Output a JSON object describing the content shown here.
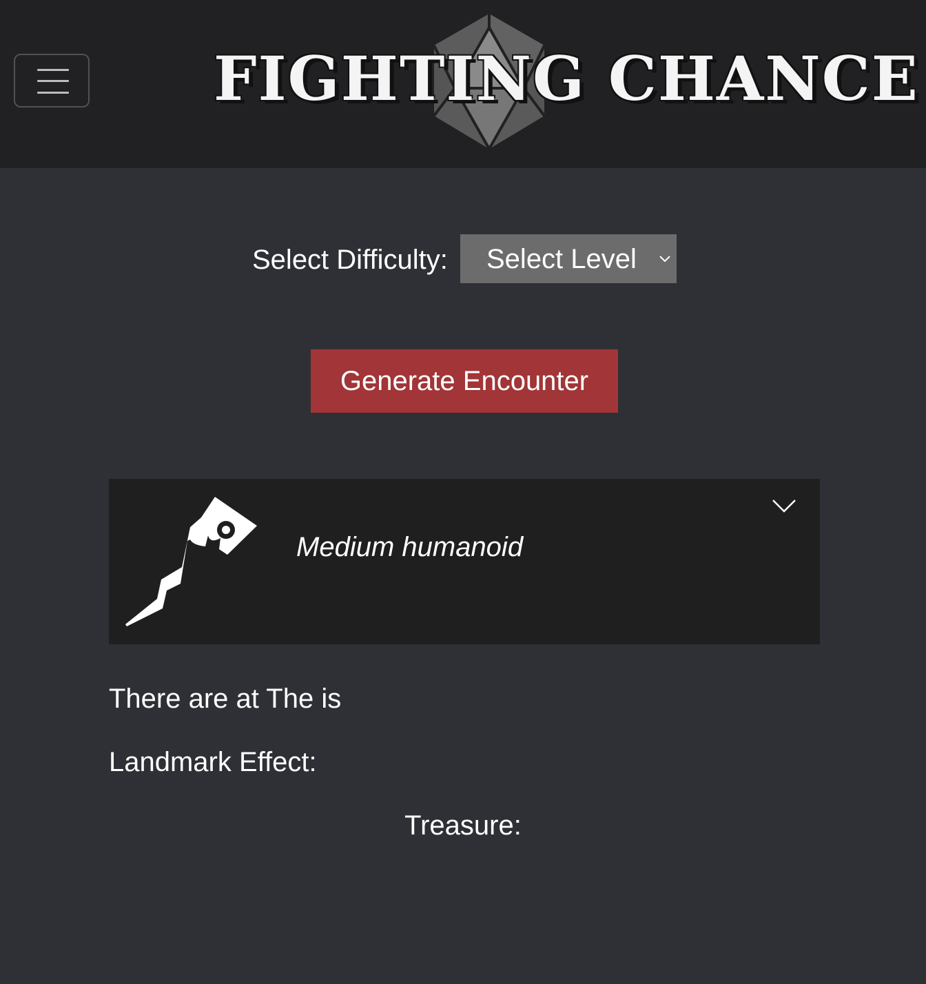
{
  "header": {
    "menu_icon": "hamburger-menu-icon",
    "logo_text": "FIGHTING CHANCE",
    "logo_icon": "d20-die-icon",
    "background": "#212123"
  },
  "controls": {
    "difficulty_label": "Select Difficulty:",
    "level_select": {
      "selected": "Select Level",
      "icon": "chevron-down-icon"
    },
    "generate_button": "Generate Encounter",
    "generate_color": "#a13537"
  },
  "encounter_card": {
    "emblem_icon": "hooked-staff-emblem-icon",
    "title": "Medium humanoid",
    "toggle_icon": "chevron-down-icon"
  },
  "details": {
    "encounter_text": "There are at The is",
    "landmark_label": "Landmark Effect:",
    "treasure_label": "Treasure:"
  },
  "colors": {
    "page_background": "#2f3035",
    "card_background": "#1f1f20",
    "select_background": "#6c6c6c"
  }
}
